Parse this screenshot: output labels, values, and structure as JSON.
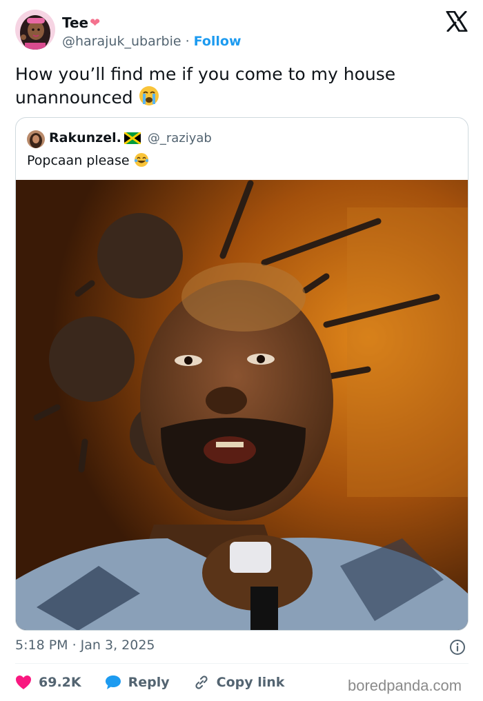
{
  "author": {
    "display_name": "Tee",
    "name_emoji": "❤",
    "handle": "@harajuk_ubarbie",
    "separator": "·",
    "follow_label": "Follow"
  },
  "tweet": {
    "text": "How you’ll find me if you come to my house unannounced"
  },
  "quote": {
    "display_name": "Rakunzel.",
    "handle": "@_raziyab",
    "text": "Popcaan please"
  },
  "meta": {
    "timestamp": "5:18 PM · Jan 3, 2025"
  },
  "actions": {
    "likes": "69.2K",
    "reply_label": "Reply",
    "copy_label": "Copy link"
  },
  "watermark": "boredpanda.com",
  "colors": {
    "link": "#1d9bf0",
    "like": "#f91880",
    "reply": "#1d9bf0",
    "muted": "#536471"
  },
  "icons": {
    "logo": "x-logo-icon",
    "info": "info-icon",
    "like": "heart-icon",
    "reply": "speech-bubble-icon",
    "copy": "link-icon"
  }
}
